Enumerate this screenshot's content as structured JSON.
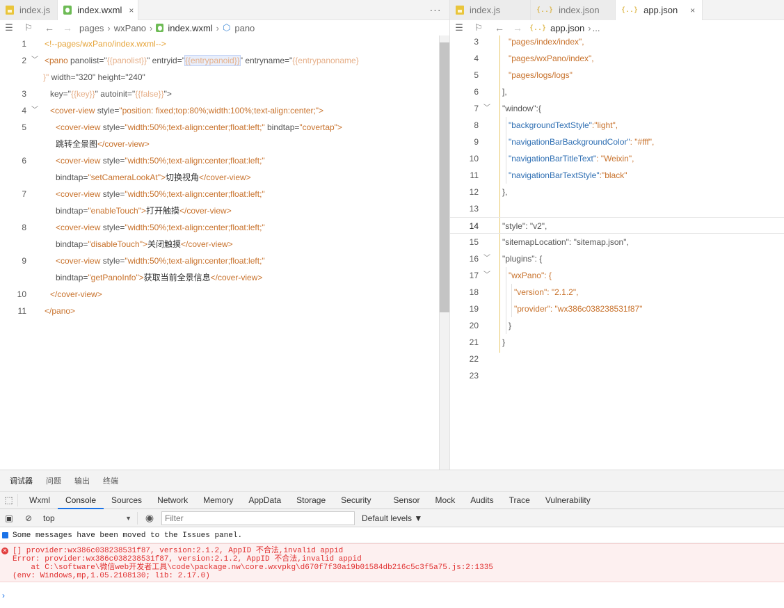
{
  "left_tabs": [
    {
      "label": "index.js",
      "icon": "js-file-icon",
      "active": false
    },
    {
      "label": "index.wxml",
      "icon": "wxml-file-icon",
      "active": true
    }
  ],
  "right_tabs": [
    {
      "label": "index.js",
      "icon": "js-file-icon",
      "active": false
    },
    {
      "label": "index.json",
      "icon": "json-file-icon",
      "active": false
    },
    {
      "label": "app.json",
      "icon": "json-file-icon",
      "active": true
    }
  ],
  "icons": {
    "json_badge": "{..}",
    "close": "×",
    "more": "···"
  },
  "left_breadcrumb": [
    "pages",
    "wxPano",
    "index.wxml",
    "pano"
  ],
  "right_breadcrumb": [
    "app.json",
    "..."
  ],
  "left_line_numbers": [
    "1",
    "2",
    "3",
    "4",
    "5",
    "6",
    "7",
    "8",
    "9",
    "10",
    "11"
  ],
  "wxml": {
    "l1": "<!--pages/wxPano/index.wxml-->",
    "l2a_open": "<pano",
    "l2a_panolist": " panolist=\"",
    "l2a_panolist_v": "{{panolist}}",
    "l2a_entryid": "\" entryid=\"",
    "l2a_entryid_v": "{{entrypanoid}}",
    "l2a_entryname": "\" entryname=\"",
    "l2a_entryname_v": "{{entrypanoname}",
    "l2b_close": "}\"",
    "l2b_rest": " width=\"320\" height=\"240\"",
    "l3_key": "key=\"",
    "l3_key_v": "{{key}}",
    "l3_auto": "\" autoinit=\"",
    "l3_auto_v": "{{false}}",
    "l3_end": "\">",
    "l4_tag": "<cover-view",
    "l4_attr": " style=",
    "l4_val": "\"position: fixed;top:80%;width:100%;text-align:center;\">",
    "cv_tag": "<cover-view",
    "cv_style": " style=",
    "cv_val_a": "\"width:50%;text-align:center;float:left;\"",
    "l5_tap": " bindtap=",
    "l5_tap_v": "\"covertap\">",
    "l5_text": "跳转全景图",
    "cv_close": "</cover-view>",
    "bindtap": "bindtap=",
    "l6_tap_v": "\"setCameraLookAt\">",
    "l6_text": "切换视角",
    "l7_tap_v": "\"enableTouch\">",
    "l7_text": "打开触摸",
    "l8_tap_v": "\"disableTouch\">",
    "l8_text": "关闭触摸",
    "l9_tap_v": "\"getPanoInfo\">",
    "l9_text": "获取当前全景信息",
    "l10": "</cover-view>",
    "l11": "</pano>"
  },
  "right_line_numbers": [
    "3",
    "4",
    "5",
    "6",
    "7",
    "8",
    "9",
    "10",
    "11",
    "12",
    "13",
    "14",
    "15",
    "16",
    "17",
    "18",
    "19",
    "20",
    "21",
    "22",
    "23"
  ],
  "appjson": {
    "l3": "\"pages/index/index\",",
    "l4": "\"pages/wxPano/index\",",
    "l5": "\"pages/logs/logs\"",
    "l6": "],",
    "l7": "\"window\":{",
    "l8k": "\"backgroundTextStyle\"",
    "l8v": ":\"light\",",
    "l9k": "\"navigationBarBackgroundColor\"",
    "l9v": ": \"#fff\",",
    "l10k": "\"navigationBarTitleText\"",
    "l10v": ": \"Weixin\",",
    "l11k": "\"navigationBarTextStyle\"",
    "l11v": ":\"black\"",
    "l12": "},",
    "l14": "\"style\": \"v2\",",
    "l15": "\"sitemapLocation\": \"sitemap.json\",",
    "l16": "\"plugins\": {",
    "l17": "\"wxPano\": {",
    "l18": "\"version\": \"2.1.2\",",
    "l19": "\"provider\": \"wx386c038238531f87\"",
    "l20": "}",
    "l21": "}"
  },
  "panel_tabs": [
    "调试器",
    "问题",
    "输出",
    "终端"
  ],
  "devtools_tabs": [
    "Wxml",
    "Console",
    "Sources",
    "Network",
    "Memory",
    "AppData",
    "Storage",
    "Security",
    "Sensor",
    "Mock",
    "Audits",
    "Trace",
    "Vulnerability"
  ],
  "console_toolbar": {
    "context": "top",
    "filter_placeholder": "Filter",
    "levels": "Default levels ▼"
  },
  "console": {
    "info": "Some messages have been moved to the Issues panel.",
    "error_lines": [
      "[] provider:wx386c038238531f87, version:2.1.2, AppID 不合法,invalid appid",
      "Error: provider:wx386c038238531f87, version:2.1.2, AppID 不合法,invalid appid",
      "    at C:\\software\\微信web开发者工具\\code\\package.nw\\core.wxvpkg\\d670f7f30a19b01584db216c5c3f5a75.js:2:1335",
      "(env: Windows,mp,1.05.2108130; lib: 2.17.0)"
    ],
    "prompt": "›"
  }
}
